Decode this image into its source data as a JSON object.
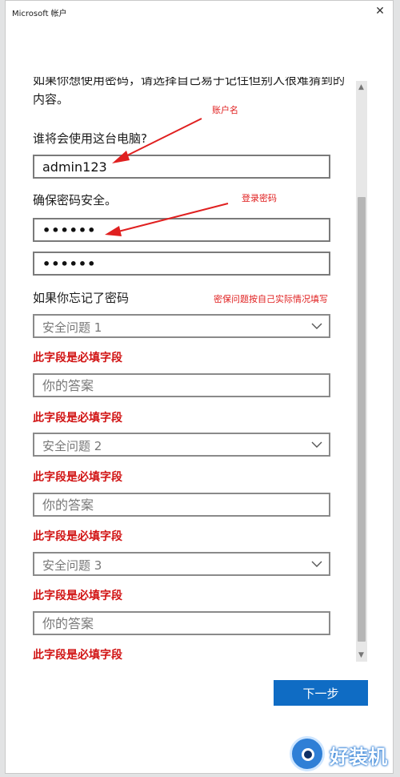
{
  "window": {
    "title": "Microsoft 帐户",
    "close_symbol": "✕"
  },
  "intro_text": "如果你想使用密码，请选择自己易于记住但别人很难猜到的内容。",
  "account": {
    "label": "谁将会使用这台电脑?",
    "username_value": "admin123"
  },
  "password": {
    "label": "确保密码安全。",
    "password_value": "••••••",
    "confirm_value": "••••••"
  },
  "security": {
    "label": "如果你忘记了密码",
    "questions": [
      {
        "placeholder": "安全问题 1",
        "answer_placeholder": "你的答案"
      },
      {
        "placeholder": "安全问题 2",
        "answer_placeholder": "你的答案"
      },
      {
        "placeholder": "安全问题 3",
        "answer_placeholder": "你的答案"
      }
    ],
    "required_error": "此字段是必填字段"
  },
  "annotations": {
    "username_note": "账户名",
    "password_note": "登录密码",
    "security_note": "密保问题按自己实际情况填写"
  },
  "actions": {
    "next_label": "下一步"
  },
  "watermark": {
    "text": "好装机"
  },
  "colors": {
    "accent": "#0f6cc4",
    "error": "#d11313",
    "annotation": "#e02020"
  }
}
